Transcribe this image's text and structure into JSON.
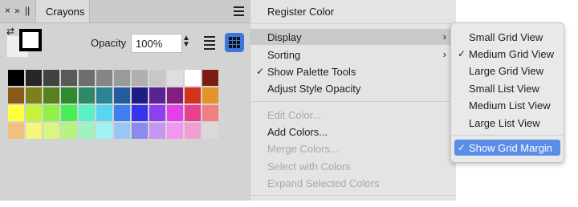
{
  "panel": {
    "close_glyph": "×",
    "expand_glyph": "»",
    "grip_glyph": "||",
    "tab_label": "Crayons",
    "opacity_label": "Opacity",
    "opacity_value": "100%"
  },
  "swatches": [
    [
      "#000000",
      "#262626",
      "#424242",
      "#595959",
      "#6e6e6e",
      "#858585",
      "#9a9a9a",
      "#b0b0b0",
      "#c7c7c7",
      "#dedede",
      "#ffffff",
      "#7a1e10"
    ],
    [
      "#8a5a17",
      "#7f7f19",
      "#55821d",
      "#2f8a2f",
      "#2c8a66",
      "#2b8493",
      "#265a9e",
      "#1d1d85",
      "#5a2293",
      "#841d80",
      "#d6331e",
      "#e5922a"
    ],
    [
      "#ffff3b",
      "#c6f23a",
      "#8ff048",
      "#48ee55",
      "#57f0c7",
      "#55d6f3",
      "#3f7ff0",
      "#3535ef",
      "#8e3ff0",
      "#e540e8",
      "#e8408f",
      "#f08080"
    ],
    [
      "#f1c07e",
      "#f6f67d",
      "#d9f67f",
      "#b5f47e",
      "#9ff3bf",
      "#9ff3f3",
      "#96c8f3",
      "#8a8af0",
      "#c696f2",
      "#f296f2",
      "#f0a0d0",
      "#d9d9d9"
    ]
  ],
  "menu": {
    "register_color": "Register Color",
    "display": "Display",
    "sorting": "Sorting",
    "show_palette_tools": "Show Palette Tools",
    "adjust_style_opacity": "Adjust Style Opacity",
    "edit_color": "Edit Color...",
    "add_colors": "Add Colors...",
    "merge_colors": "Merge Colors...",
    "select_with_colors": "Select with Colors",
    "expand_selected_colors": "Expand Selected Colors",
    "submenu_arrow": "›",
    "check": "✓"
  },
  "submenu": {
    "small_grid": "Small Grid View",
    "medium_grid": "Medium Grid View",
    "large_grid": "Large Grid View",
    "small_list": "Small List View",
    "medium_list": "Medium List View",
    "large_list": "Large List View",
    "show_grid_margin": "Show Grid Margin"
  },
  "colors": {
    "accent": "#3d76db",
    "selection": "#5a8de8"
  },
  "icons": [
    "close-icon",
    "expand-icon",
    "grip-icon",
    "hamburger-icon",
    "swap-icon",
    "stepper-icon",
    "list-view-icon",
    "grid-view-icon",
    "chevron-right-icon",
    "checkmark-icon"
  ]
}
